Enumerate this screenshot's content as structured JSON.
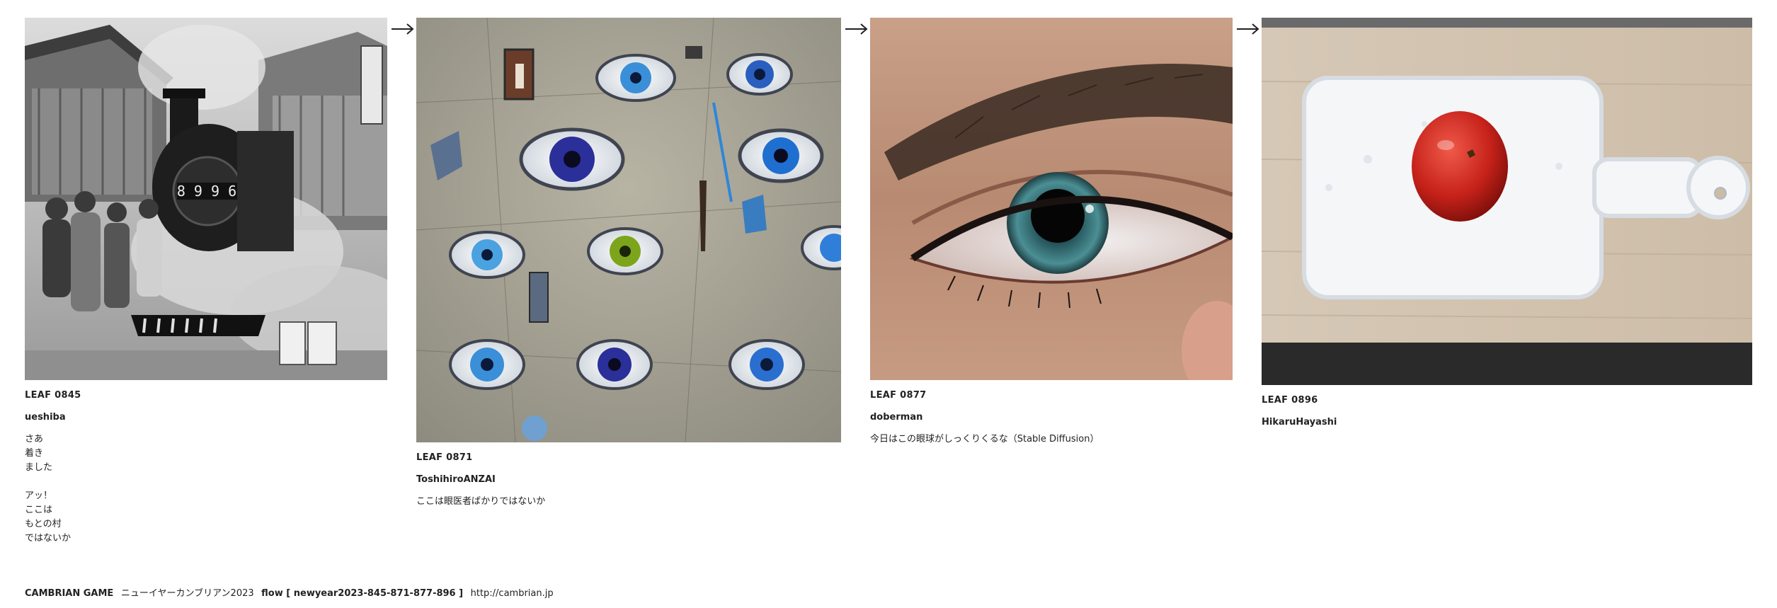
{
  "leaves": [
    {
      "title": "LEAF 0845",
      "author": "ueshiba",
      "caption": "さあ\n着き\nました\n\nアッ！\nここは\nもとの村\nではないか",
      "image_icon": "steam-locomotive-photo"
    },
    {
      "title": "LEAF 0871",
      "author": "ToshihiroANZAI",
      "caption": "ここは眼医者ばかりではないか",
      "image_icon": "surreal-eyes-painting"
    },
    {
      "title": "LEAF 0877",
      "author": "doberman",
      "caption": "今日はこの眼球がしっくりくるな（Stable Diffusion）",
      "image_icon": "eye-closeup-photo"
    },
    {
      "title": "LEAF 0896",
      "author": "HikaruHayashi",
      "caption": "",
      "image_icon": "tomato-on-cutting-board-photo"
    }
  ],
  "arrow_icon": "right-arrow-icon",
  "footer": {
    "game": "CAMBRIAN GAME",
    "event": "ニューイヤーカンブリアン2023",
    "flow": "flow [ newyear2023-845-871-877-896 ]",
    "url": "http://cambrian.jp"
  }
}
